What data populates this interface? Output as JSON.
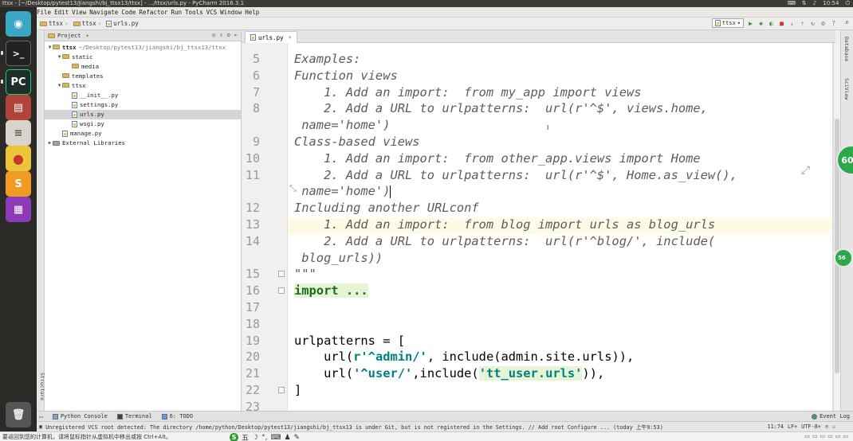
{
  "os": {
    "window_title": "ttsx - [~/Desktop/pytest13/Jiangshi/bj_ttsx13/ttsx] - .../ttsx/urls.py - PyCharm 2016.3.1",
    "clock": "10:54"
  },
  "menubar": [
    "File",
    "Edit",
    "View",
    "Navigate",
    "Code",
    "Refactor",
    "Run",
    "Tools",
    "VCS",
    "Window",
    "Help"
  ],
  "breadcrumb": {
    "items": [
      "ttsx",
      "ttsx",
      "urls.py"
    ]
  },
  "run_config": "ttsx",
  "project_panel": {
    "title": "Project",
    "tree": [
      {
        "label": "ttsx",
        "path": "~/Desktop/pytest13/jiangshi/bj_ttsx13/ttsx",
        "indent": 0,
        "arrow": "▼",
        "icon": "folder"
      },
      {
        "label": "static",
        "indent": 1,
        "arrow": "▼",
        "icon": "folder"
      },
      {
        "label": "media",
        "indent": 2,
        "arrow": "",
        "icon": "folder"
      },
      {
        "label": "templates",
        "indent": 1,
        "arrow": "",
        "icon": "folder"
      },
      {
        "label": "ttsx",
        "indent": 1,
        "arrow": "▼",
        "icon": "folder"
      },
      {
        "label": "__init__.py",
        "indent": 2,
        "arrow": "",
        "icon": "py"
      },
      {
        "label": "settings.py",
        "indent": 2,
        "arrow": "",
        "icon": "py"
      },
      {
        "label": "urls.py",
        "indent": 2,
        "arrow": "",
        "icon": "py",
        "selected": true
      },
      {
        "label": "wsgi.py",
        "indent": 2,
        "arrow": "",
        "icon": "py"
      },
      {
        "label": "manage.py",
        "indent": 1,
        "arrow": "",
        "icon": "py"
      },
      {
        "label": "External Libraries",
        "indent": 0,
        "arrow": "▶",
        "icon": "lib"
      }
    ]
  },
  "editor": {
    "tab_label": "urls.py",
    "lines": [
      {
        "no": "5",
        "text": "Examples:"
      },
      {
        "no": "6",
        "text": "Function views"
      },
      {
        "no": "7",
        "text": "    1. Add an import:  from my_app import views"
      },
      {
        "no": "8",
        "text": "    2. Add a URL to urlpatterns:  url(r'^$', views.home,"
      },
      {
        "no": "",
        "text": " name='home')"
      },
      {
        "no": "9",
        "text": "Class-based views"
      },
      {
        "no": "10",
        "text": "    1. Add an import:  from other_app.views import Home"
      },
      {
        "no": "11",
        "text": "    2. Add a URL to urlpatterns:  url(r'^$', Home.as_view(),"
      },
      {
        "no": "",
        "text": " name='home')"
      },
      {
        "no": "12",
        "text": "Including another URLconf"
      },
      {
        "no": "13",
        "text": "    1. Add an import:  from blog import urls as blog_urls"
      },
      {
        "no": "14",
        "text": "    2. Add a URL to urlpatterns:  url(r'^blog/', include("
      },
      {
        "no": "",
        "text": " blog_urls))"
      },
      {
        "no": "15",
        "text": "\"\"\""
      },
      {
        "no": "16",
        "text": "import ..."
      },
      {
        "no": "17",
        "text": ""
      },
      {
        "no": "18",
        "text": ""
      },
      {
        "no": "19",
        "text": "urlpatterns = ["
      },
      {
        "no": "20",
        "text": "    url(r'^admin/', include(admin.site.urls)),"
      },
      {
        "no": "21",
        "text": "    url('^user/',include('tt_user.urls')),"
      },
      {
        "no": "22",
        "text": "]"
      },
      {
        "no": "23",
        "text": ""
      }
    ]
  },
  "tool_buttons": [
    "Python Console",
    "Terminal",
    "6: TODO"
  ],
  "event_log": "Event Log",
  "status": {
    "message": "Unregistered VCS root detected: The directory /home/python/Desktop/pytest13/jiangshi/bj_ttsx13 is under Git, but is not registered in the Settings. // Add root  Configure ... (today 上午9:53)",
    "position": "11:74",
    "line_sep": "LF÷",
    "encoding": "UTF-8÷"
  },
  "ime": {
    "hint": "要返回到您的计算机，请将鼠标指针从虚拟机中移出或按 Ctrl+Alt。",
    "s_label": "S",
    "wu_label": "五"
  },
  "bubbles": [
    "60",
    "56"
  ],
  "colors": {
    "selection": "#d5d5d5",
    "caret_line": "#fffae3",
    "docstring": "#5c5c5c",
    "keyword": "#000080",
    "string": "#008080"
  }
}
